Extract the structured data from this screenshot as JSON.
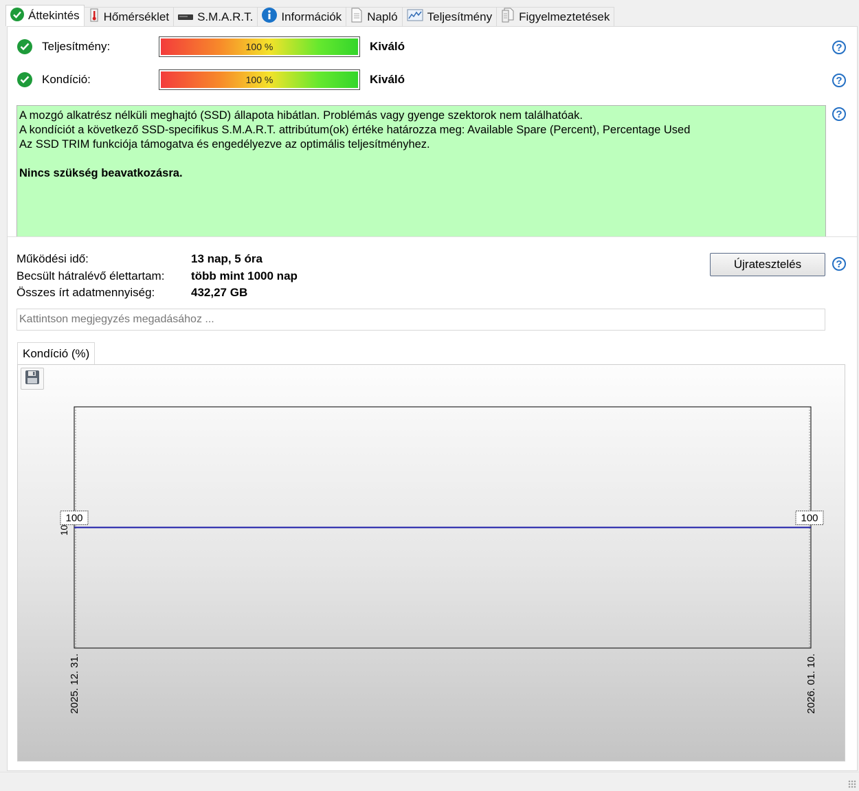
{
  "tabs": [
    {
      "label": "Áttekintés",
      "icon": "check-circle-icon",
      "active": true
    },
    {
      "label": "Hőmérséklet",
      "icon": "thermometer-icon"
    },
    {
      "label": "S.M.A.R.T.",
      "icon": "drive-icon"
    },
    {
      "label": "Információk",
      "icon": "info-icon"
    },
    {
      "label": "Napló",
      "icon": "document-icon"
    },
    {
      "label": "Teljesítmény",
      "icon": "performance-chart-icon"
    },
    {
      "label": "Figyelmeztetések",
      "icon": "alerts-icon"
    }
  ],
  "performance": {
    "label": "Teljesítmény:",
    "percent_text": "100 %",
    "value": 100,
    "rating": "Kiváló"
  },
  "condition": {
    "label": "Kondíció:",
    "percent_text": "100 %",
    "value": 100,
    "rating": "Kiváló"
  },
  "status": {
    "line1": "A mozgó alkatrész nélküli meghajtó (SSD) állapota hibátlan. Problémás vagy gyenge szektorok nem találhatóak.",
    "line2": "A kondíciót a következő SSD-specifikus S.M.A.R.T. attribútum(ok) értéke határozza meg:  Available Spare (Percent), Percentage Used",
    "line3": "Az SSD TRIM funkciója támogatva és engedélyezve az optimális teljesítményhez.",
    "action": "Nincs szükség beavatkozásra.",
    "background": "#bdffbd"
  },
  "info": {
    "uptime_label": "Működési idő:",
    "uptime_value": "13 nap, 5 óra",
    "lifetime_label": "Becsült hátralévő élettartam:",
    "lifetime_value": "több mint 1000 nap",
    "written_label": "Összes írt adatmennyiség:",
    "written_value": "432,27 GB"
  },
  "retest_label": "Újratesztelés",
  "note_placeholder": "Kattintson megjegyzés megadásához ...",
  "chart_tab_label": "Kondíció  (%)",
  "chart_data": {
    "type": "line",
    "x": [
      "2025. 12. 31.",
      "2026. 01. 10."
    ],
    "series": [
      {
        "values": [
          100,
          100
        ],
        "color": "#1a1aa8"
      }
    ],
    "data_labels": [
      "100",
      "100"
    ],
    "y_tick_label": "10",
    "title": "",
    "xlabel": "",
    "ylabel": "",
    "grid": false
  }
}
